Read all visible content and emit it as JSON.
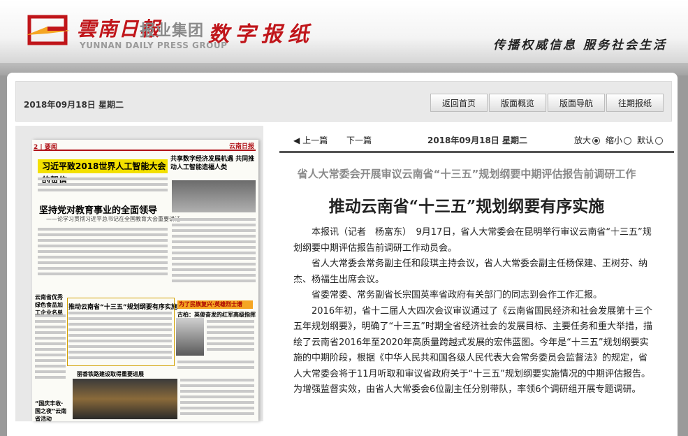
{
  "header": {
    "logo_cn": "雲南日報",
    "logo_group": "报业集团",
    "logo_en": "YUNNAN DAILY PRESS GROUP",
    "site_name": "数字报纸",
    "slogan": "传播权威信息  服务社会生活",
    "brand_color": "#c0151a"
  },
  "topbar": {
    "date": "2018年09月18日  星期二",
    "nav": [
      "返回首页",
      "版面概览",
      "版面导航",
      "往期报纸"
    ]
  },
  "paper_thumb": {
    "page_no": "2",
    "page_label": "要闻",
    "mast": "云南日报",
    "h1": "习近平致2018世界人工智能大会的贺信",
    "h2": "坚持党对教育事业的全面领导",
    "h2_sub": "——论学习贯彻习近平总书记在全国教育大会重要讲话",
    "h3": "共享数字经济发展机遇 共同推动人工智能造福人类",
    "h4": "推动云南省“十三五”规划纲要有序实施",
    "h5": "为了民族复兴·英雄烈士谱",
    "h5b": "古柏：英俊奋发的红军高级指挥员",
    "h6": "丽香铁路建设取得重要进展",
    "h7": "云南省优秀绿色食品加工企业名单",
    "h8": "“国庆丰收·国之夜”云南省活动"
  },
  "article_toolbar": {
    "prev": "上一篇",
    "next": "下一篇",
    "date": "2018年09月18日  星期二",
    "zoom_in": "放大",
    "zoom_out": "缩小",
    "default": "默认"
  },
  "article": {
    "subtitle": "省人大常委会开展审议云南省“十三五”规划纲要中期评估报告前调研工作",
    "title": "推动云南省“十三五”规划纲要有序实施",
    "paragraphs": [
      "本报讯（记者　杨富东）　9月17日，省人大常委会在昆明举行审议云南省“十三五”规划纲要中期评估报告前调研工作动员会。",
      "省人大常委会常务副主任和段琪主持会议，省人大常委会副主任杨保建、王树芬、纳杰、杨福生出席会议。",
      "省委常委、常务副省长宗国英率省政府有关部门的同志到会作工作汇报。",
      "2016年初，省十二届人大四次会议审议通过了《云南省国民经济和社会发展第十三个五年规划纲要》，明确了“十三五”时期全省经济社会的发展目标、主要任务和重大举措，描绘了云南省2016年至2020年高质量跨越式发展的宏伟蓝图。今年是“十三五”规划纲要实施的中期阶段，根据《中华人民共和国各级人民代表大会常务委员会监督法》的规定，省人大常委会将于11月听取和审议省政府关于“十三五”规划纲要实施情况的中期评估报告。为增强监督实效，由省人大常委会6位副主任分别带队，率领6个调研组开展专题调研。"
    ]
  }
}
